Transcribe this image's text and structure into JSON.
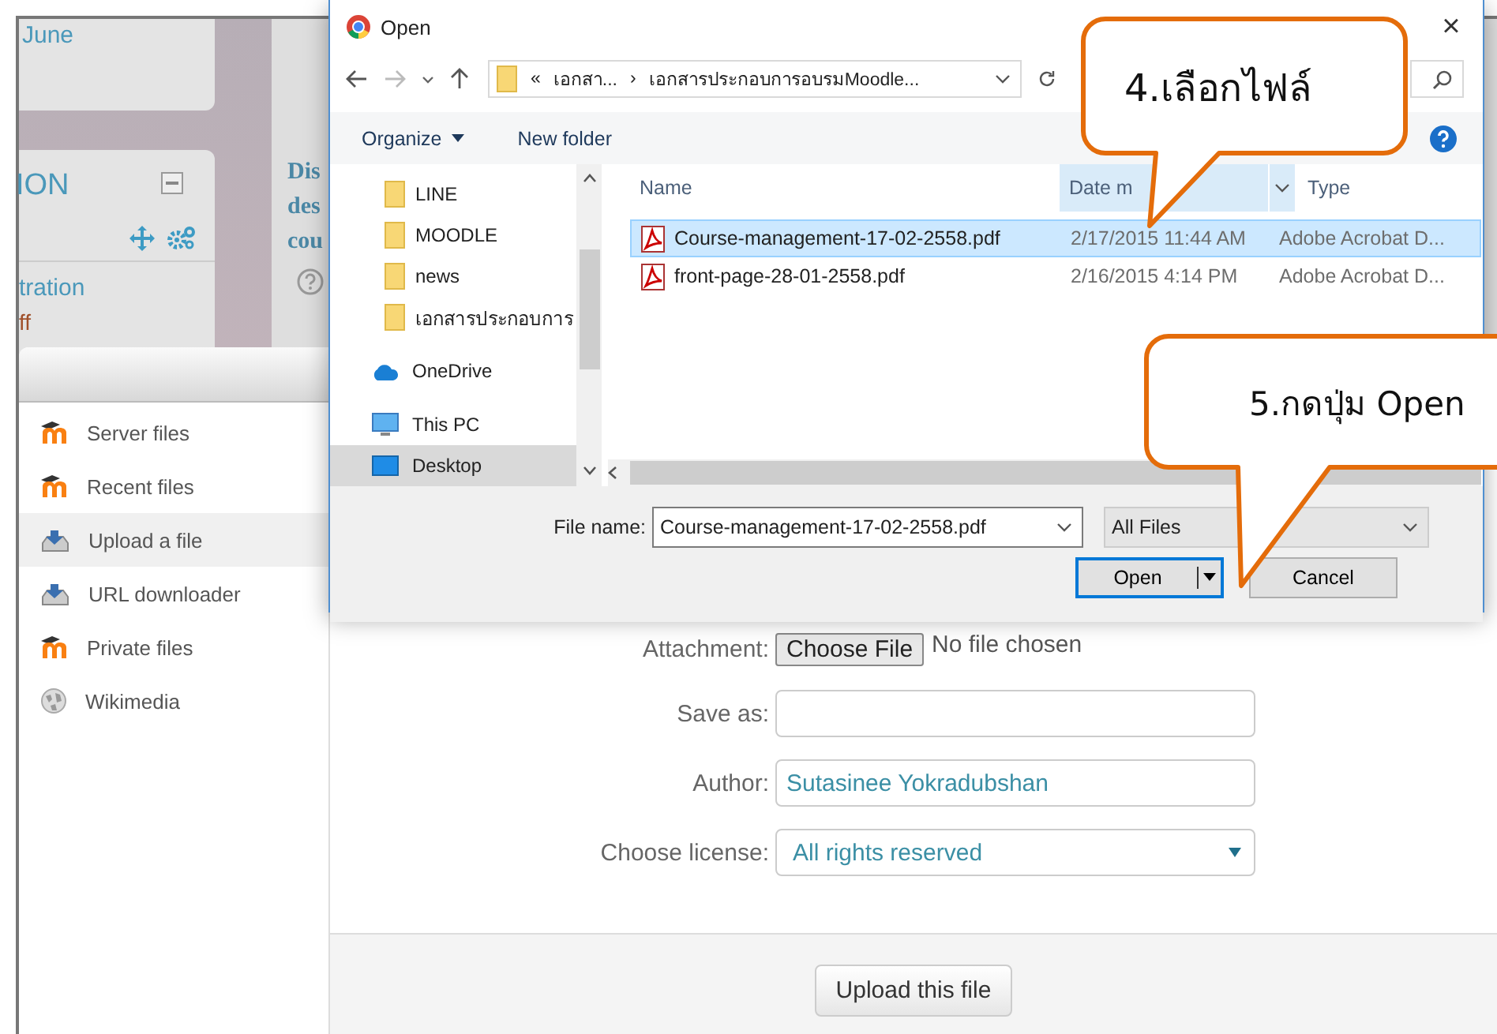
{
  "background_page": {
    "calendar_text": "June",
    "block_title": "ION",
    "block_link": "tration",
    "block_status": "ff",
    "content_lines": [
      "Dis",
      "des",
      "cou"
    ]
  },
  "file_picker": {
    "repositories": [
      {
        "label": "Server files",
        "kind": "moodle",
        "selected": false
      },
      {
        "label": "Recent files",
        "kind": "moodle",
        "selected": false
      },
      {
        "label": "Upload a file",
        "kind": "upload",
        "selected": true
      },
      {
        "label": "URL downloader",
        "kind": "upload",
        "selected": false
      },
      {
        "label": "Private files",
        "kind": "moodle",
        "selected": false
      },
      {
        "label": "Wikimedia",
        "kind": "wiki",
        "selected": false
      }
    ],
    "form": {
      "attachment_label": "Attachment:",
      "choose_button": "Choose File",
      "no_file": "No file chosen",
      "save_as_label": "Save as:",
      "author_label": "Author:",
      "author_value": "Sutasinee Yokradubshan",
      "license_label": "Choose license:",
      "license_value": "All rights reserved",
      "upload_button": "Upload this file"
    }
  },
  "open_dialog": {
    "title": "Open",
    "close": "×",
    "path": [
      "«",
      "เอกสา...",
      "›",
      "เอกสารประกอบการอบรมMoodle..."
    ],
    "toolbar": {
      "organize": "Organize",
      "new_folder": "New folder"
    },
    "nav_items": [
      {
        "label": "LINE",
        "kind": "folder",
        "selected": false
      },
      {
        "label": "MOODLE",
        "kind": "folder",
        "selected": false
      },
      {
        "label": "news",
        "kind": "folder",
        "selected": false
      },
      {
        "label": "เอกสารประกอบการ",
        "kind": "folder",
        "selected": false
      },
      {
        "label": "OneDrive",
        "kind": "cloud",
        "selected": false
      },
      {
        "label": "This PC",
        "kind": "pc",
        "selected": false
      },
      {
        "label": "Desktop",
        "kind": "desktop",
        "selected": true
      }
    ],
    "columns": [
      "Name",
      "Date m",
      "Type"
    ],
    "files": [
      {
        "name": "Course-management-17-02-2558.pdf",
        "date": "2/17/2015 11:44 AM",
        "type": "Adobe Acrobat D...",
        "selected": true
      },
      {
        "name": "front-page-28-01-2558.pdf",
        "date": "2/16/2015 4:14 PM",
        "type": "Adobe Acrobat D...",
        "selected": false
      }
    ],
    "file_name_label": "File name:",
    "file_name_value": "Course-management-17-02-2558.pdf",
    "filter": "All Files",
    "open_button": "Open",
    "cancel_button": "Cancel"
  },
  "callouts": [
    {
      "text": "4.เลือกไฟล์"
    },
    {
      "text": "5.กดปุ่ม Open"
    }
  ]
}
